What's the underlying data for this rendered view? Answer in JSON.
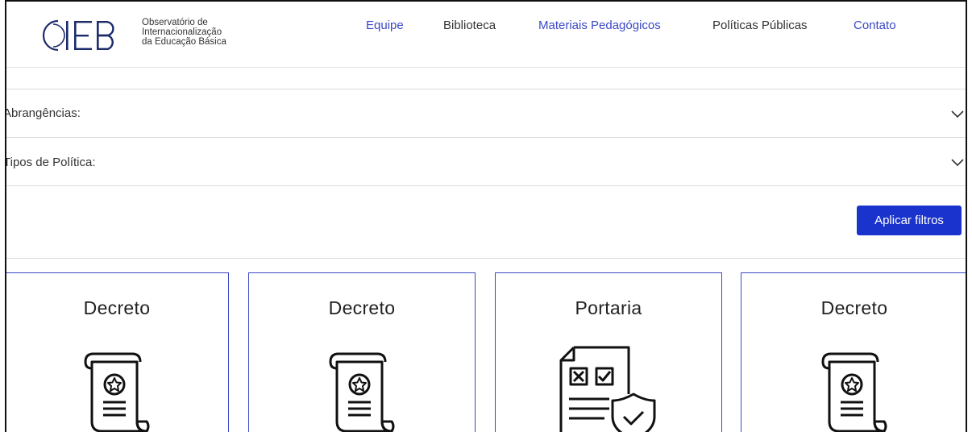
{
  "header": {
    "logo": {
      "brand": "OIEB",
      "line1": "Observatório de",
      "line2": "Internacionalização",
      "line3": "da Educação Básica"
    },
    "nav": [
      {
        "label": "Equipe"
      },
      {
        "label": "Biblioteca"
      },
      {
        "label": "Materiais Pedagógicos"
      },
      {
        "label": "Políticas Públicas"
      },
      {
        "label": "Contato"
      }
    ]
  },
  "filters": {
    "abrangencias_label": "Abrangências:",
    "tipos_label": "Tipos de Política:",
    "apply_label": "Aplicar filtros"
  },
  "cards": [
    {
      "title": "Decreto",
      "icon": "scroll-document-icon"
    },
    {
      "title": "Decreto",
      "icon": "scroll-document-icon"
    },
    {
      "title": "Portaria",
      "icon": "checklist-shield-icon"
    },
    {
      "title": "Decreto",
      "icon": "scroll-document-icon"
    }
  ],
  "colors": {
    "accent": "#1a33cc",
    "nav_blue": "#3b49c6",
    "card_border": "#3b49c6"
  }
}
